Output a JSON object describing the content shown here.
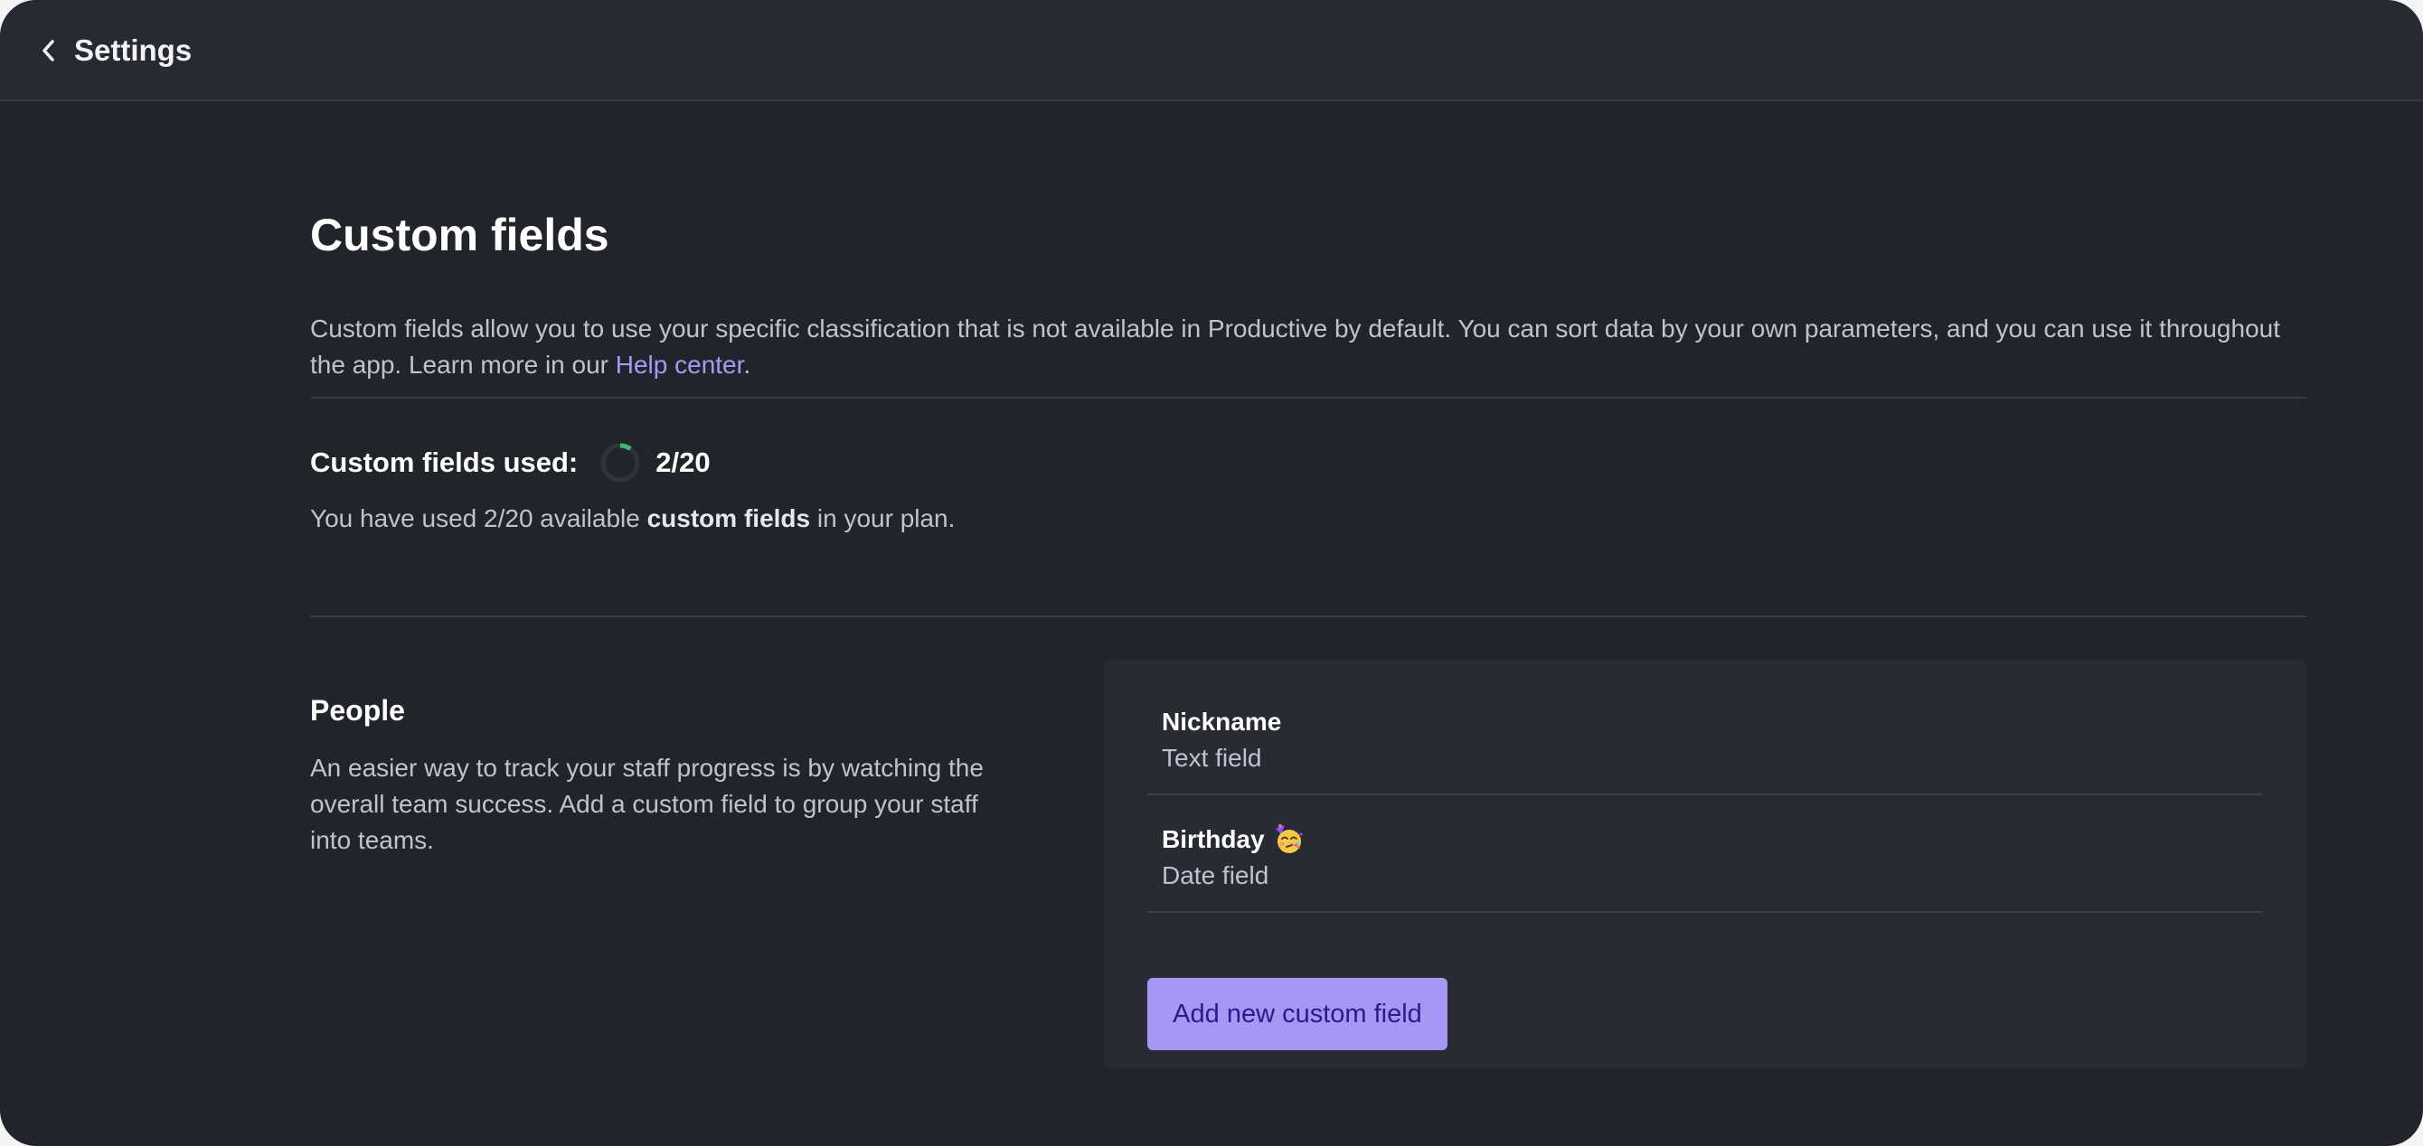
{
  "header": {
    "back_label": "Settings"
  },
  "page": {
    "title": "Custom fields",
    "intro_text": "Custom fields allow you to use your specific classification that is not available in Productive by default. You can sort data by your own parameters, and you can use it throughout the app. Learn more in our ",
    "help_link_label": "Help center",
    "intro_end": "."
  },
  "usage": {
    "label": "Custom fields used:",
    "count_label": "2/20",
    "used": 2,
    "limit": 20,
    "note_prefix": "You have used 2/20 available ",
    "note_bold": "custom fields",
    "note_suffix": " in your plan.",
    "ring_color": "#3fb87a"
  },
  "people": {
    "title": "People",
    "description": "An easier way to track your staff progress is by watching the overall team success. Add a custom field to group your staff into teams.",
    "fields": [
      {
        "name": "Nickname",
        "type": "Text field",
        "icon": ""
      },
      {
        "name": "Birthday",
        "type": "Date field",
        "icon": "partying-face-icon"
      }
    ],
    "add_button_label": "Add new custom field"
  },
  "colors": {
    "background": "#22242c",
    "accent": "#a797f4",
    "link": "#a999f5"
  }
}
